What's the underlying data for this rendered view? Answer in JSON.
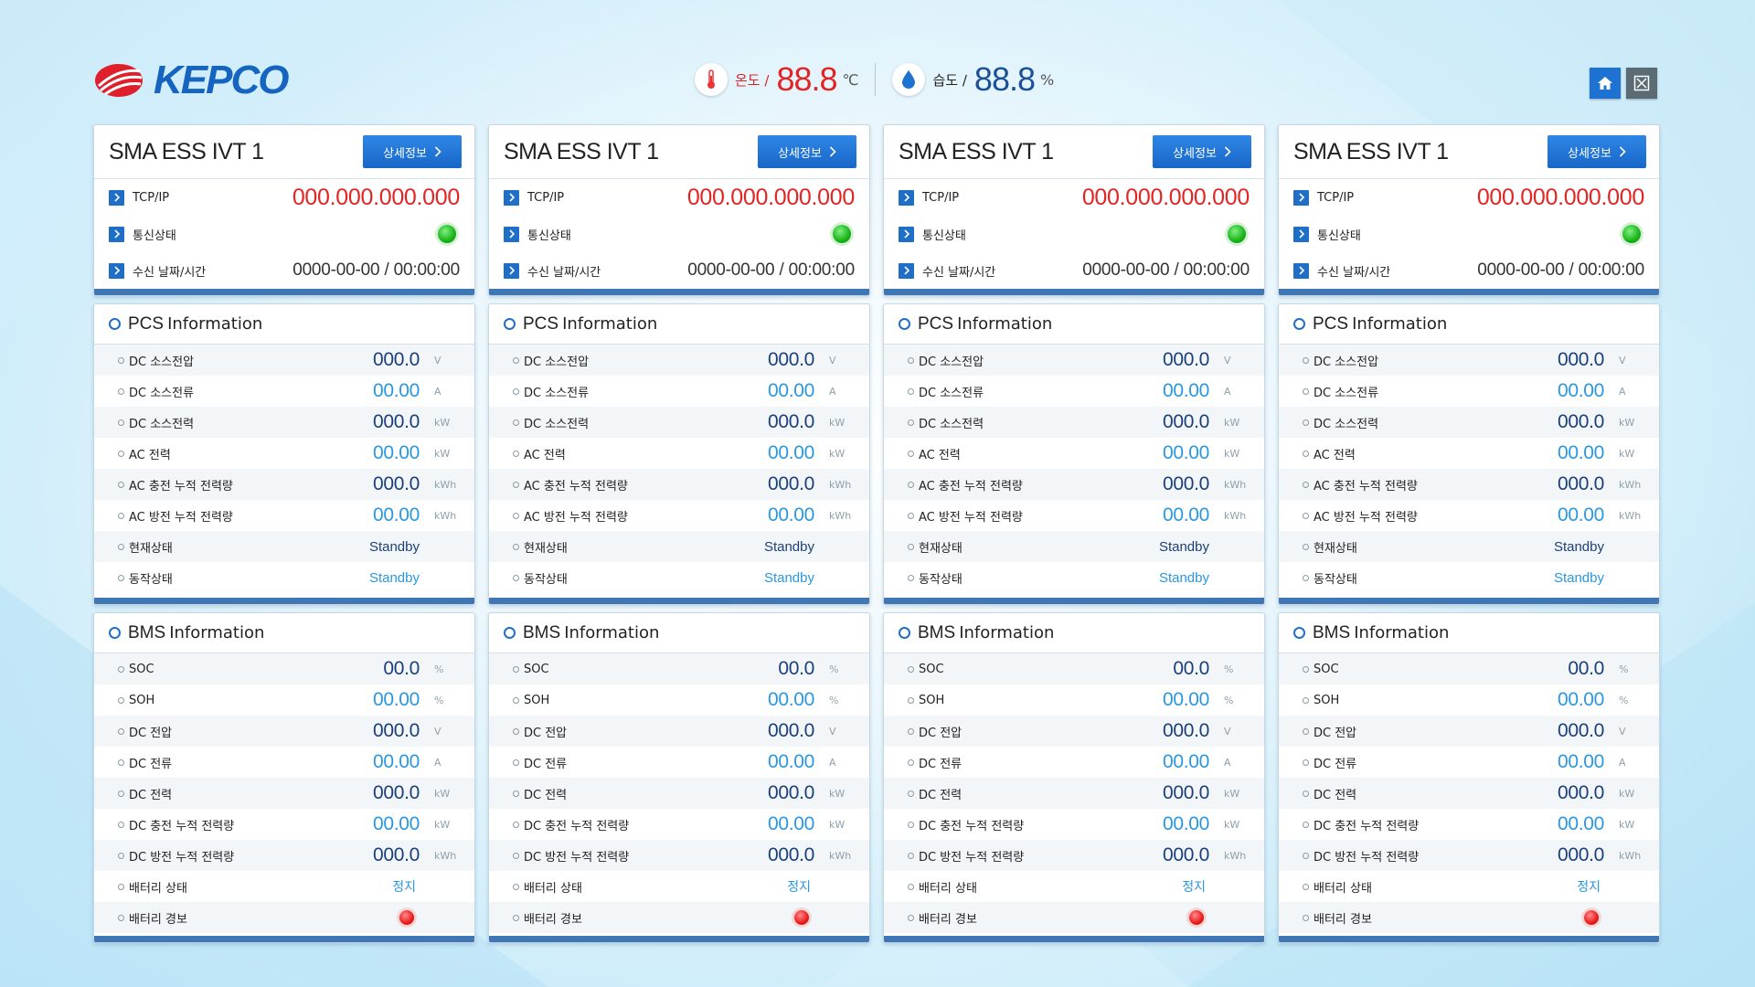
{
  "header": {
    "logo_text": "KEPCO",
    "temperature": {
      "label": "온도 /",
      "value": "88.8",
      "unit": "℃"
    },
    "humidity": {
      "label": "습도 /",
      "value": "88.8",
      "unit": "%"
    },
    "buttons": {
      "home": "home-icon",
      "close": "close-icon"
    }
  },
  "colors": {
    "accent": "#1e73d2",
    "ip_red": "#e32424",
    "status_green": "#18b318",
    "alarm_red": "#e81b1b",
    "value_navy": "#1b3f7a",
    "value_sky": "#2a97e2"
  },
  "units": [
    {
      "device": {
        "title": "SMA ESS IVT 1",
        "detail_label": "상세정보",
        "tcp_label": "TCP/IP",
        "tcp_value": "000.000.000.000",
        "comm_label": "통신상태",
        "comm_status": "on",
        "time_label": "수신 날짜/시간",
        "time_value": "0000-00-00 / 00:00:00"
      },
      "pcs": {
        "title_bold": "PCS",
        "title_rest": "Information",
        "rows": [
          {
            "label": "DC 소스전압",
            "value": "000.0",
            "unit": "V"
          },
          {
            "label": "DC 소스전류",
            "value": "00.00",
            "unit": "A"
          },
          {
            "label": "DC 소스전력",
            "value": "000.0",
            "unit": "kW"
          },
          {
            "label": "AC 전력",
            "value": "00.00",
            "unit": "kW"
          },
          {
            "label": "AC 충전 누적 전력량",
            "value": "000.0",
            "unit": "kWh"
          },
          {
            "label": "AC 방전 누적 전력량",
            "value": "00.00",
            "unit": "kWh"
          },
          {
            "label": "현재상태",
            "value": "Standby",
            "unit": ""
          },
          {
            "label": "동작상태",
            "value": "Standby",
            "unit": ""
          }
        ]
      },
      "bms": {
        "title_bold": "BMS",
        "title_rest": "Information",
        "rows": [
          {
            "label": "SOC",
            "value": "00.0",
            "unit": "%"
          },
          {
            "label": "SOH",
            "value": "00.00",
            "unit": "%"
          },
          {
            "label": "DC 전압",
            "value": "000.0",
            "unit": "V"
          },
          {
            "label": "DC 전류",
            "value": "00.00",
            "unit": "A"
          },
          {
            "label": "DC 전력",
            "value": "000.0",
            "unit": "kW"
          },
          {
            "label": "DC 충전 누적 전력량",
            "value": "00.00",
            "unit": "kW"
          },
          {
            "label": "DC 방전 누적 전력량",
            "value": "000.0",
            "unit": "kWh"
          },
          {
            "label": "배터리 상태",
            "value": "정지",
            "unit": ""
          },
          {
            "label": "배터리 경보",
            "value": "",
            "unit": ""
          }
        ]
      }
    },
    {
      "device": {
        "title": "SMA ESS IVT 1",
        "detail_label": "상세정보",
        "tcp_label": "TCP/IP",
        "tcp_value": "000.000.000.000",
        "comm_label": "통신상태",
        "comm_status": "on",
        "time_label": "수신 날짜/시간",
        "time_value": "0000-00-00 / 00:00:00"
      },
      "pcs": {
        "title_bold": "PCS",
        "title_rest": "Information",
        "rows": [
          {
            "label": "DC 소스전압",
            "value": "000.0",
            "unit": "V"
          },
          {
            "label": "DC 소스전류",
            "value": "00.00",
            "unit": "A"
          },
          {
            "label": "DC 소스전력",
            "value": "000.0",
            "unit": "kW"
          },
          {
            "label": "AC 전력",
            "value": "00.00",
            "unit": "kW"
          },
          {
            "label": "AC 충전 누적 전력량",
            "value": "000.0",
            "unit": "kWh"
          },
          {
            "label": "AC 방전 누적 전력량",
            "value": "00.00",
            "unit": "kWh"
          },
          {
            "label": "현재상태",
            "value": "Standby",
            "unit": ""
          },
          {
            "label": "동작상태",
            "value": "Standby",
            "unit": ""
          }
        ]
      },
      "bms": {
        "title_bold": "BMS",
        "title_rest": "Information",
        "rows": [
          {
            "label": "SOC",
            "value": "00.0",
            "unit": "%"
          },
          {
            "label": "SOH",
            "value": "00.00",
            "unit": "%"
          },
          {
            "label": "DC 전압",
            "value": "000.0",
            "unit": "V"
          },
          {
            "label": "DC 전류",
            "value": "00.00",
            "unit": "A"
          },
          {
            "label": "DC 전력",
            "value": "000.0",
            "unit": "kW"
          },
          {
            "label": "DC 충전 누적 전력량",
            "value": "00.00",
            "unit": "kW"
          },
          {
            "label": "DC 방전 누적 전력량",
            "value": "000.0",
            "unit": "kWh"
          },
          {
            "label": "배터리 상태",
            "value": "정지",
            "unit": ""
          },
          {
            "label": "배터리 경보",
            "value": "",
            "unit": ""
          }
        ]
      }
    },
    {
      "device": {
        "title": "SMA ESS IVT 1",
        "detail_label": "상세정보",
        "tcp_label": "TCP/IP",
        "tcp_value": "000.000.000.000",
        "comm_label": "통신상태",
        "comm_status": "on",
        "time_label": "수신 날짜/시간",
        "time_value": "0000-00-00 / 00:00:00"
      },
      "pcs": {
        "title_bold": "PCS",
        "title_rest": "Information",
        "rows": [
          {
            "label": "DC 소스전압",
            "value": "000.0",
            "unit": "V"
          },
          {
            "label": "DC 소스전류",
            "value": "00.00",
            "unit": "A"
          },
          {
            "label": "DC 소스전력",
            "value": "000.0",
            "unit": "kW"
          },
          {
            "label": "AC 전력",
            "value": "00.00",
            "unit": "kW"
          },
          {
            "label": "AC 충전 누적 전력량",
            "value": "000.0",
            "unit": "kWh"
          },
          {
            "label": "AC 방전 누적 전력량",
            "value": "00.00",
            "unit": "kWh"
          },
          {
            "label": "현재상태",
            "value": "Standby",
            "unit": ""
          },
          {
            "label": "동작상태",
            "value": "Standby",
            "unit": ""
          }
        ]
      },
      "bms": {
        "title_bold": "BMS",
        "title_rest": "Information",
        "rows": [
          {
            "label": "SOC",
            "value": "00.0",
            "unit": "%"
          },
          {
            "label": "SOH",
            "value": "00.00",
            "unit": "%"
          },
          {
            "label": "DC 전압",
            "value": "000.0",
            "unit": "V"
          },
          {
            "label": "DC 전류",
            "value": "00.00",
            "unit": "A"
          },
          {
            "label": "DC 전력",
            "value": "000.0",
            "unit": "kW"
          },
          {
            "label": "DC 충전 누적 전력량",
            "value": "00.00",
            "unit": "kW"
          },
          {
            "label": "DC 방전 누적 전력량",
            "value": "000.0",
            "unit": "kWh"
          },
          {
            "label": "배터리 상태",
            "value": "정지",
            "unit": ""
          },
          {
            "label": "배터리 경보",
            "value": "",
            "unit": ""
          }
        ]
      }
    },
    {
      "device": {
        "title": "SMA ESS IVT 1",
        "detail_label": "상세정보",
        "tcp_label": "TCP/IP",
        "tcp_value": "000.000.000.000",
        "comm_label": "통신상태",
        "comm_status": "on",
        "time_label": "수신 날짜/시간",
        "time_value": "0000-00-00 / 00:00:00"
      },
      "pcs": {
        "title_bold": "PCS",
        "title_rest": "Information",
        "rows": [
          {
            "label": "DC 소스전압",
            "value": "000.0",
            "unit": "V"
          },
          {
            "label": "DC 소스전류",
            "value": "00.00",
            "unit": "A"
          },
          {
            "label": "DC 소스전력",
            "value": "000.0",
            "unit": "kW"
          },
          {
            "label": "AC 전력",
            "value": "00.00",
            "unit": "kW"
          },
          {
            "label": "AC 충전 누적 전력량",
            "value": "000.0",
            "unit": "kWh"
          },
          {
            "label": "AC 방전 누적 전력량",
            "value": "00.00",
            "unit": "kWh"
          },
          {
            "label": "현재상태",
            "value": "Standby",
            "unit": ""
          },
          {
            "label": "동작상태",
            "value": "Standby",
            "unit": ""
          }
        ]
      },
      "bms": {
        "title_bold": "BMS",
        "title_rest": "Information",
        "rows": [
          {
            "label": "SOC",
            "value": "00.0",
            "unit": "%"
          },
          {
            "label": "SOH",
            "value": "00.00",
            "unit": "%"
          },
          {
            "label": "DC 전압",
            "value": "000.0",
            "unit": "V"
          },
          {
            "label": "DC 전류",
            "value": "00.00",
            "unit": "A"
          },
          {
            "label": "DC 전력",
            "value": "000.0",
            "unit": "kW"
          },
          {
            "label": "DC 충전 누적 전력량",
            "value": "00.00",
            "unit": "kW"
          },
          {
            "label": "DC 방전 누적 전력량",
            "value": "000.0",
            "unit": "kWh"
          },
          {
            "label": "배터리 상태",
            "value": "정지",
            "unit": ""
          },
          {
            "label": "배터리 경보",
            "value": "",
            "unit": ""
          }
        ]
      }
    }
  ]
}
